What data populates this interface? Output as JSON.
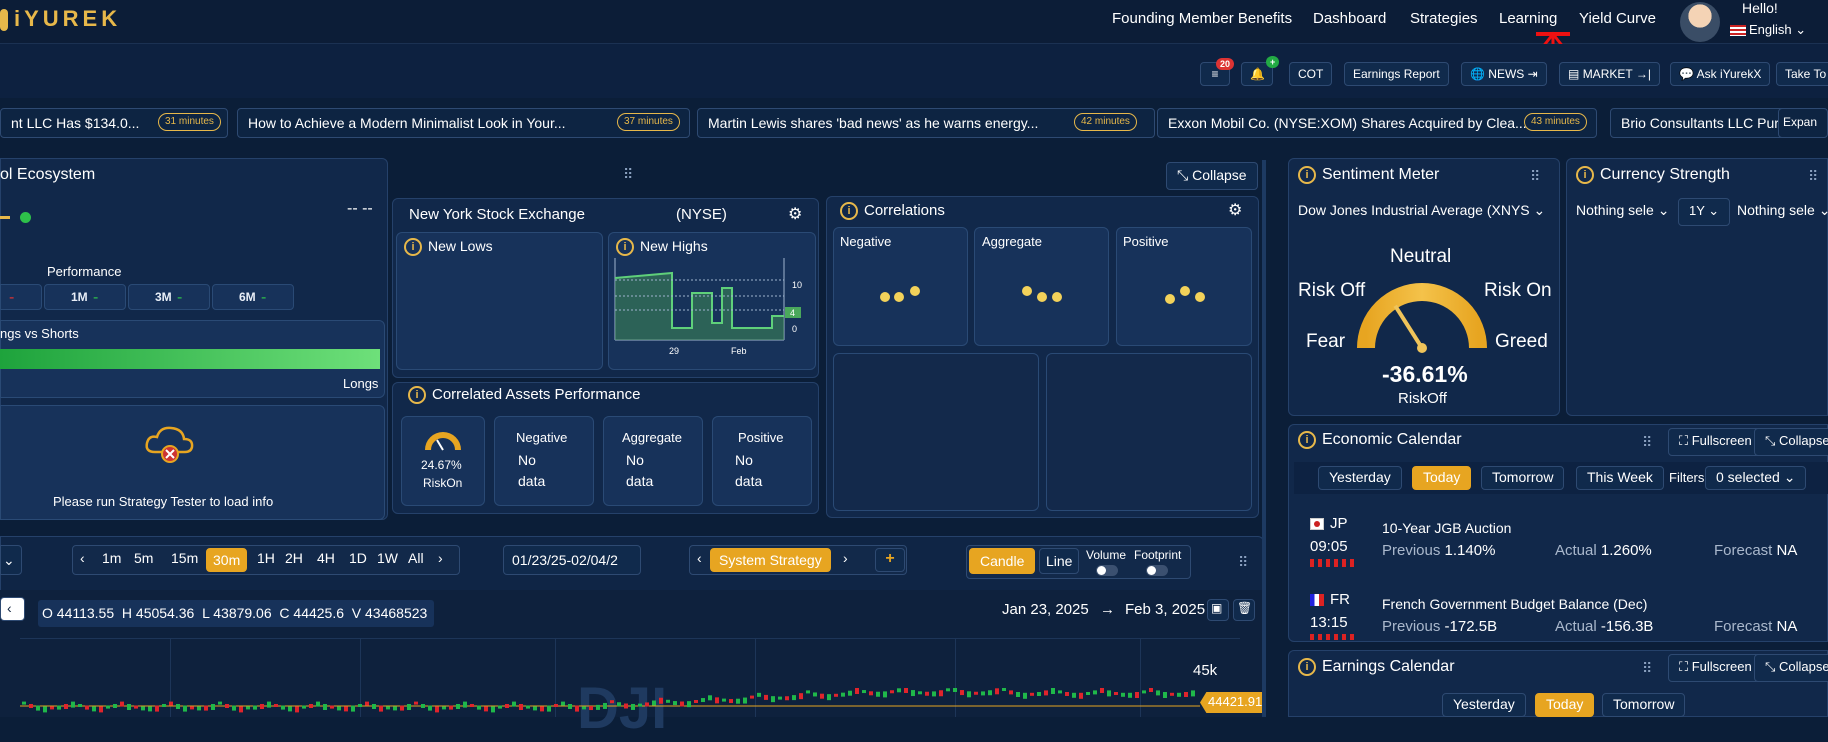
{
  "logo": {
    "text": "iYUREK"
  },
  "nav": {
    "items": [
      "Founding Member Benefits",
      "Dashboard",
      "Strategies",
      "Learning",
      "Yield Curve"
    ]
  },
  "user": {
    "greeting": "Hello!",
    "language": "English",
    "flag": "us-flag-icon"
  },
  "toolbar": {
    "menu_badge": "20",
    "notif_badge": "+",
    "cot": "COT",
    "earnings": "Earnings Report",
    "news": "NEWS",
    "market": "MARKET",
    "ask": "Ask iYurekX",
    "take": "Take To"
  },
  "ticker": [
    {
      "text": "nt LLC Has $134.0...",
      "time": "31 minutes"
    },
    {
      "text": "How to Achieve a Modern Minimalist Look in Your...",
      "time": "37 minutes"
    },
    {
      "text": "Martin Lewis shares 'bad news' as he warns energy...",
      "time": "42 minutes"
    },
    {
      "text": "Exxon Mobil Co. (NYSE:XOM) Shares Acquired by Clea...",
      "time": "43 minutes"
    },
    {
      "text": "Brio Consultants LLC Pur",
      "time": ""
    }
  ],
  "ticker_expand": "Expan",
  "ecosystem": {
    "title": "ol Ecosystem",
    "collapse": "Collapse",
    "dashes": "-- --",
    "performance": "Performance",
    "periods": [
      "-",
      "1M",
      "3M",
      "6M"
    ],
    "period_marks": [
      "-",
      "-",
      "-",
      "-"
    ],
    "longs_title": "ngs vs Shorts",
    "longs_label": "Longs",
    "strategy_msg": "Please run Strategy Tester to load info"
  },
  "nyse": {
    "name": "New York Stock Exchange",
    "code": "(NYSE)",
    "new_lows": "New Lows",
    "new_highs": "New Highs",
    "axis": [
      "10",
      "4",
      "0"
    ],
    "dates": [
      "29",
      "Feb"
    ]
  },
  "correlated": {
    "title": "Correlated Assets Performance",
    "gauge_value": "24.67%",
    "gauge_label": "RiskOn",
    "cols": [
      {
        "name": "Negative",
        "v1": "No",
        "v2": "data"
      },
      {
        "name": "Aggregate",
        "v1": "No",
        "v2": "data"
      },
      {
        "name": "Positive",
        "v1": "No",
        "v2": "data"
      }
    ]
  },
  "correlations": {
    "title": "Correlations",
    "cols": [
      "Negative",
      "Aggregate",
      "Positive"
    ]
  },
  "sentiment": {
    "title": "Sentiment Meter",
    "asset": "Dow Jones Industrial Average (XNYS",
    "neutral": "Neutral",
    "risk_off": "Risk Off",
    "risk_on": "Risk On",
    "fear": "Fear",
    "greed": "Greed",
    "value": "-36.61%",
    "state": "RiskOff",
    "needle_pct": 0.32
  },
  "currency": {
    "title": "Currency Strength",
    "sel1": "Nothing sele",
    "period": "1Y",
    "sel2": "Nothing sele"
  },
  "economic": {
    "title": "Economic Calendar",
    "fullscreen": "Fullscreen",
    "collapse": "Collapse",
    "days": [
      "Yesterday",
      "Today",
      "Tomorrow",
      "This Week"
    ],
    "filters": "Filters",
    "selected": "0 selected",
    "events": [
      {
        "country": "JP",
        "time": "09:05",
        "name": "10-Year JGB Auction",
        "prev_label": "Previous",
        "prev": "1.140%",
        "act_label": "Actual",
        "act": "1.260%",
        "fc_label": "Forecast",
        "fc": "NA"
      },
      {
        "country": "FR",
        "time": "13:15",
        "name": "French Government Budget Balance (Dec)",
        "prev_label": "Previous",
        "prev": "-172.5B",
        "act_label": "Actual",
        "act": "-156.3B",
        "fc_label": "Forecast",
        "fc": "NA"
      }
    ]
  },
  "earnings": {
    "title": "Earnings Calendar",
    "fullscreen": "Fullscreen",
    "collapse": "Collapse",
    "days": [
      "Yesterday",
      "Today",
      "Tomorrow"
    ]
  },
  "chartbar": {
    "timeframes": [
      "1m",
      "5m",
      "15m",
      "30m",
      "1H",
      "2H",
      "4H",
      "1D",
      "1W",
      "All"
    ],
    "active": "30m",
    "range": "01/23/25-02/04/2",
    "strategy": "System Strategy",
    "candle": "Candle",
    "line": "Line",
    "volume": "Volume",
    "footprint": "Footprint"
  },
  "chart": {
    "ohlc": "O 44113.55  H 45054.36  L 43879.06  C 44425.6  V 43468523",
    "from": "Jan 23, 2025",
    "arrow": "→",
    "to": "Feb 3, 2025",
    "price_tag": "44421.91",
    "level": "45k",
    "watermark": "DJI"
  }
}
